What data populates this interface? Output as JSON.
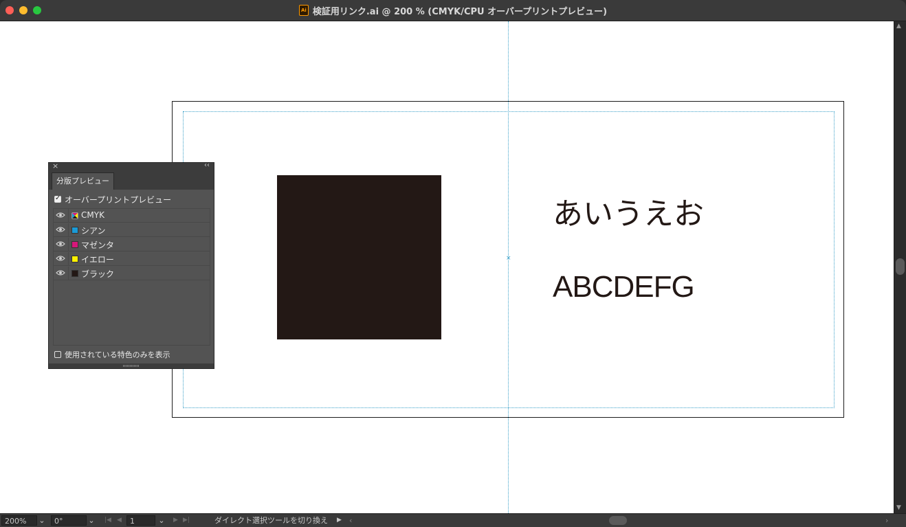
{
  "window": {
    "title": "検証用リンク.ai @ 200 % (CMYK/CPU オーバープリントプレビュー)",
    "app_icon_text": "Ai"
  },
  "artwork": {
    "japanese_text": "あいうえお",
    "latin_text": "ABCDEFG",
    "square_color": "#231815",
    "guide_color": "#3aa0c8"
  },
  "panel": {
    "tab_label": "分版プレビュー",
    "overprint_label": "オーバープリントプレビュー",
    "overprint_checked": true,
    "separations": [
      {
        "label": "CMYK",
        "color": "cmyk-composite",
        "visible": true
      },
      {
        "label": "シアン",
        "color": "#1b9ad6",
        "visible": true
      },
      {
        "label": "マゼンタ",
        "color": "#d6177a",
        "visible": true
      },
      {
        "label": "イエロー",
        "color": "#fff100",
        "visible": true
      },
      {
        "label": "ブラック",
        "color": "#231815",
        "visible": true
      }
    ],
    "spot_only_label": "使用されている特色のみを表示",
    "spot_only_checked": false
  },
  "statusbar": {
    "zoom": "200%",
    "rotation": "0°",
    "page": "1",
    "status_text": "ダイレクト選択ツールを切り換え"
  }
}
